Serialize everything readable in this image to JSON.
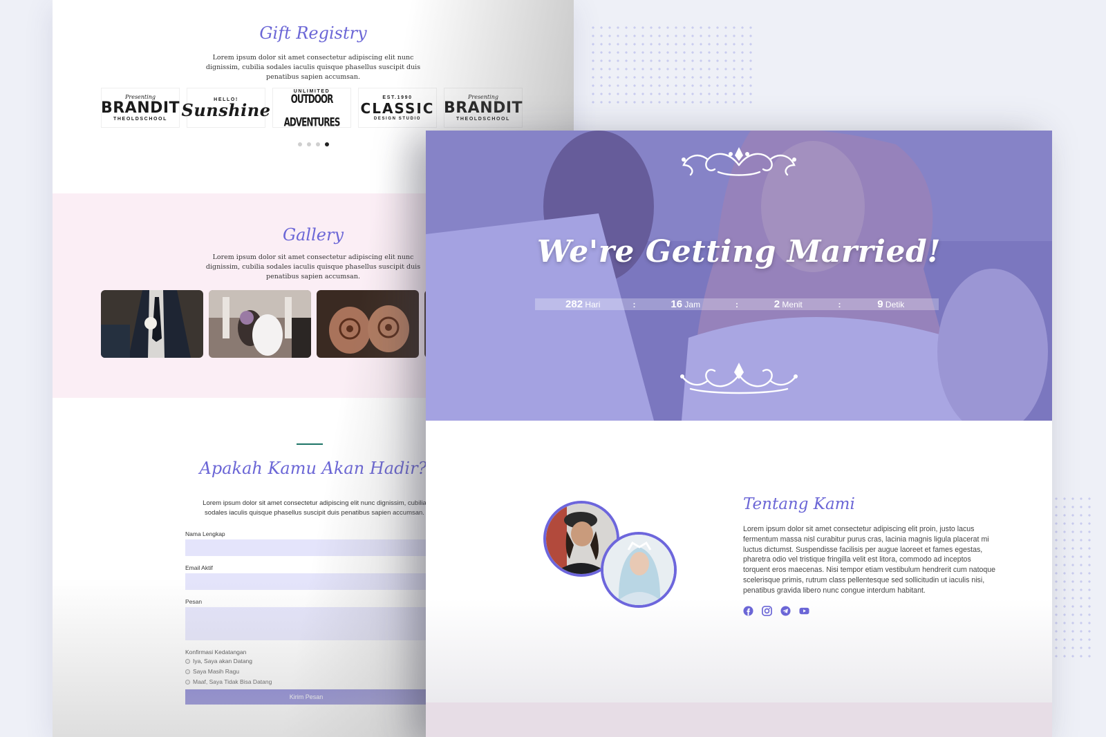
{
  "gift": {
    "title": "Gift Registry",
    "text": "Lorem ipsum dolor sit amet consectetur adipiscing elit nunc dignissim, cubilia sodales iaculis quisque phasellus suscipit duis penatibus sapien accumsan.",
    "logos": [
      {
        "top": "Presenting",
        "main": "BRANDIT",
        "bottom": "THEOLDSCHOOL"
      },
      {
        "top": "HELLO!",
        "main": "Sunshine",
        "bottom": ""
      },
      {
        "top": "UNLIMITED",
        "main": "OUTDOOR ADVENTURES",
        "bottom": ""
      },
      {
        "top": "EST.1990",
        "main": "CLASSIC",
        "bottom": "DESIGN STUDIO"
      },
      {
        "top": "Presenting",
        "main": "BRANDIT",
        "bottom": "THEOLDSCHOOL"
      }
    ],
    "slider_active_index": 3
  },
  "gallery": {
    "title": "Gallery",
    "text": "Lorem ipsum dolor sit amet consectetur adipiscing elit nunc dignissim, cubilia sodales iaculis quisque phasellus suscipit duis penatibus sapien accumsan."
  },
  "rsvp": {
    "title": "Apakah Kamu Akan Hadir?",
    "text": "Lorem ipsum dolor sit amet consectetur adipiscing elit nunc dignissim, cubilia sodales iaculis quisque phasellus suscipit duis penatibus sapien accumsan.",
    "name_label": "Nama Lengkap",
    "email_label": "Email Aktif",
    "message_label": "Pesan",
    "confirm_label": "Konfirmasi Kedatangan",
    "options": [
      "Iya, Saya akan Datang",
      "Saya Masih Ragu",
      "Maaf, Saya Tidak Bisa Datang"
    ],
    "submit_label": "Kirim Pesan"
  },
  "hero": {
    "title": "We're Getting Married!",
    "countdown": {
      "days": "282",
      "days_label": "Hari",
      "hours": "16",
      "hours_label": "Jam",
      "minutes": "2",
      "minutes_label": "Menit",
      "seconds": "9",
      "seconds_label": "Detik",
      "separator": ":"
    }
  },
  "about": {
    "title": "Tentang Kami",
    "text": "Lorem ipsum dolor sit amet consectetur adipiscing elit proin, justo lacus fermentum massa nisl curabitur purus cras, lacinia magnis ligula placerat mi luctus dictumst. Suspendisse facilisis per augue laoreet et fames egestas, pharetra odio vel tristique fringilla velit est litora, commodo ad inceptos torquent eros maecenas. Nisi tempor etiam vestibulum hendrerit cum natoque scelerisque primis, rutrum class pellentesque sed sollicitudin ut iaculis nisi, penatibus gravida libero nunc congue interdum habitant.",
    "socials": [
      "facebook-icon",
      "instagram-icon",
      "telegram-icon",
      "youtube-icon"
    ]
  },
  "colors": {
    "accent": "#6b66d6",
    "hero_overlay": "#6c68d2",
    "gallery_bg": "#fbeef5",
    "field_bg": "#e4e4fb",
    "button": "#6a65cc"
  }
}
